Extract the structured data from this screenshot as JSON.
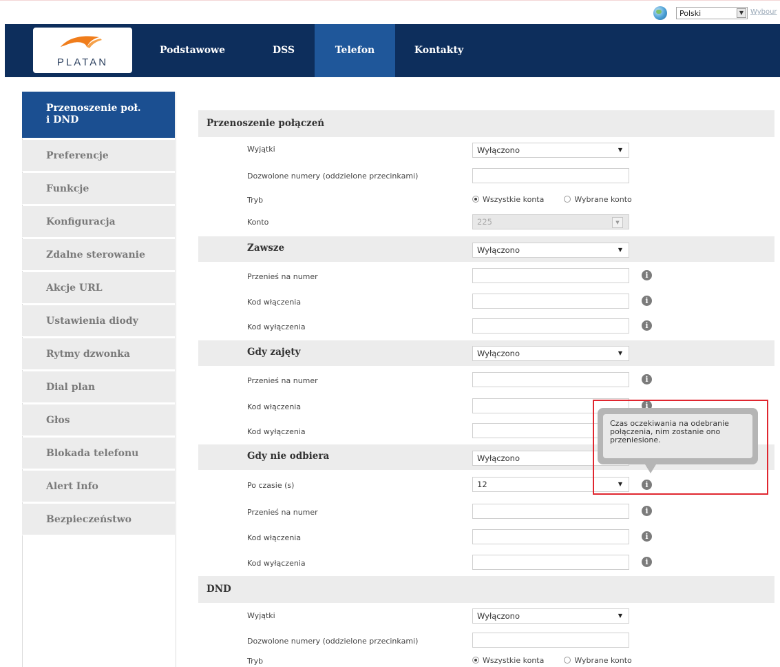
{
  "language": {
    "selected": "Polski",
    "link": "Wybour"
  },
  "logo": {
    "text": "PLATAN"
  },
  "nav": {
    "tabs": [
      "Podstawowe",
      "DSS",
      "Telefon",
      "Kontakty"
    ],
    "active": "Telefon"
  },
  "sidebar": {
    "items": [
      {
        "label": "Przenoszenie poł. i DND",
        "line1": "Przenoszenie poł.",
        "line2": "i DND"
      },
      {
        "label": "Preferencje"
      },
      {
        "label": "Funkcje"
      },
      {
        "label": "Konfiguracja"
      },
      {
        "label": "Zdalne sterowanie"
      },
      {
        "label": "Akcje URL"
      },
      {
        "label": "Ustawienia diody"
      },
      {
        "label": "Rytmy dzwonka"
      },
      {
        "label": "Dial plan"
      },
      {
        "label": "Głos"
      },
      {
        "label": "Blokada telefonu"
      },
      {
        "label": "Alert Info"
      },
      {
        "label": "Bezpieczeństwo"
      }
    ]
  },
  "forward": {
    "title": "Przenoszenie połączeń",
    "exceptions_label": "Wyjątki",
    "exceptions_value": "Wyłączono",
    "allowed_label": "Dozwolone numery (oddzielone przecinkami)",
    "mode_label": "Tryb",
    "mode_all": "Wszystkie konta",
    "mode_selected": "Wybrane konto",
    "account_label": "Konto",
    "account_value": "225"
  },
  "always": {
    "title": "Zawsze",
    "value": "Wyłączono",
    "forward_to": "Przenieś na numer",
    "on_code": "Kod włączenia",
    "off_code": "Kod wyłączenia"
  },
  "busy": {
    "title": "Gdy zajęty",
    "value": "Wyłączono",
    "forward_to": "Przenieś na numer",
    "on_code": "Kod włączenia",
    "off_code": "Kod wyłączenia"
  },
  "noanswer": {
    "title": "Gdy nie odbiera",
    "value": "Wyłączono",
    "timeout_label": "Po czasie (s)",
    "timeout_value": "12",
    "forward_to": "Przenieś na numer",
    "on_code": "Kod włączenia",
    "off_code": "Kod wyłączenia"
  },
  "tooltip": {
    "text": "Czas oczekiwania na odebranie połączenia, nim zostanie ono przeniesione."
  },
  "dnd": {
    "title": "DND",
    "exceptions_label": "Wyjątki",
    "exceptions_value": "Wyłączono",
    "allowed_label": "Dozwolone numery (oddzielone przecinkami)",
    "mode_label": "Tryb",
    "mode_all": "Wszystkie konta",
    "mode_selected": "Wybrane konto"
  },
  "colors": {
    "navbar": "#0d2e5c",
    "nav_active": "#1f579a",
    "sidebar_active": "#1b4f91",
    "highlight": "#e0262f",
    "logo_orange": "#f07d1b"
  },
  "icons": {
    "info": "i",
    "caret": "▼",
    "lang_caret": "▼"
  }
}
